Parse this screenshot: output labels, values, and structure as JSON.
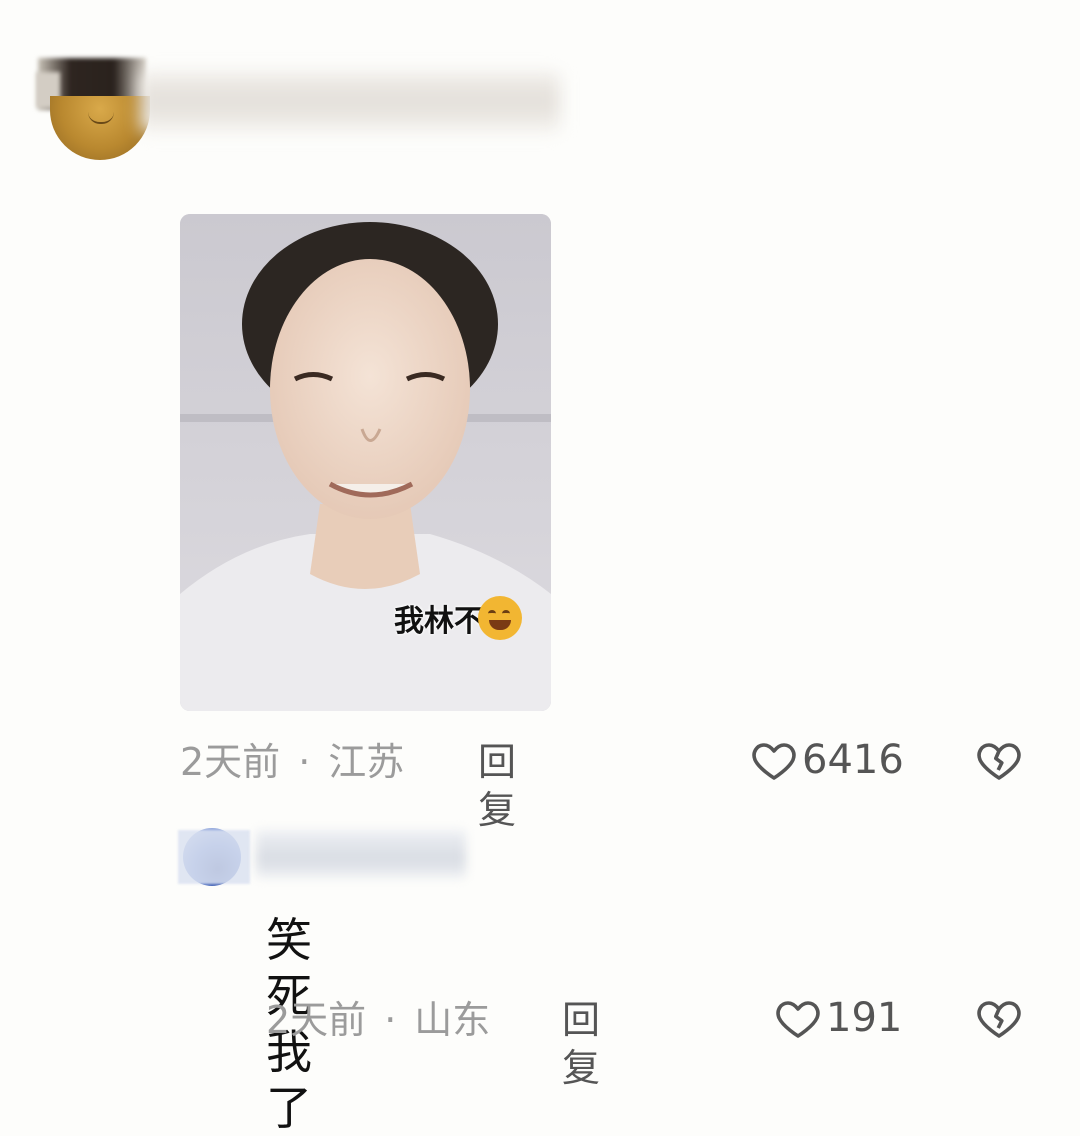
{
  "comment1": {
    "photo_caption": "我林不",
    "time": "2天前",
    "location": "江苏",
    "reply_label": "回复",
    "likes": "6416"
  },
  "comment2": {
    "text": "笑死我了",
    "time": "2天前",
    "location": "山东",
    "reply_label": "回复",
    "likes": "191"
  },
  "separator": "·",
  "icons": {
    "like": "heart-outline-icon",
    "dislike": "broken-heart-icon"
  },
  "colors": {
    "background": "#fdfdfb",
    "meta_text": "#9b9b9b",
    "icon": "#555555",
    "emoji": "#f2b632"
  }
}
